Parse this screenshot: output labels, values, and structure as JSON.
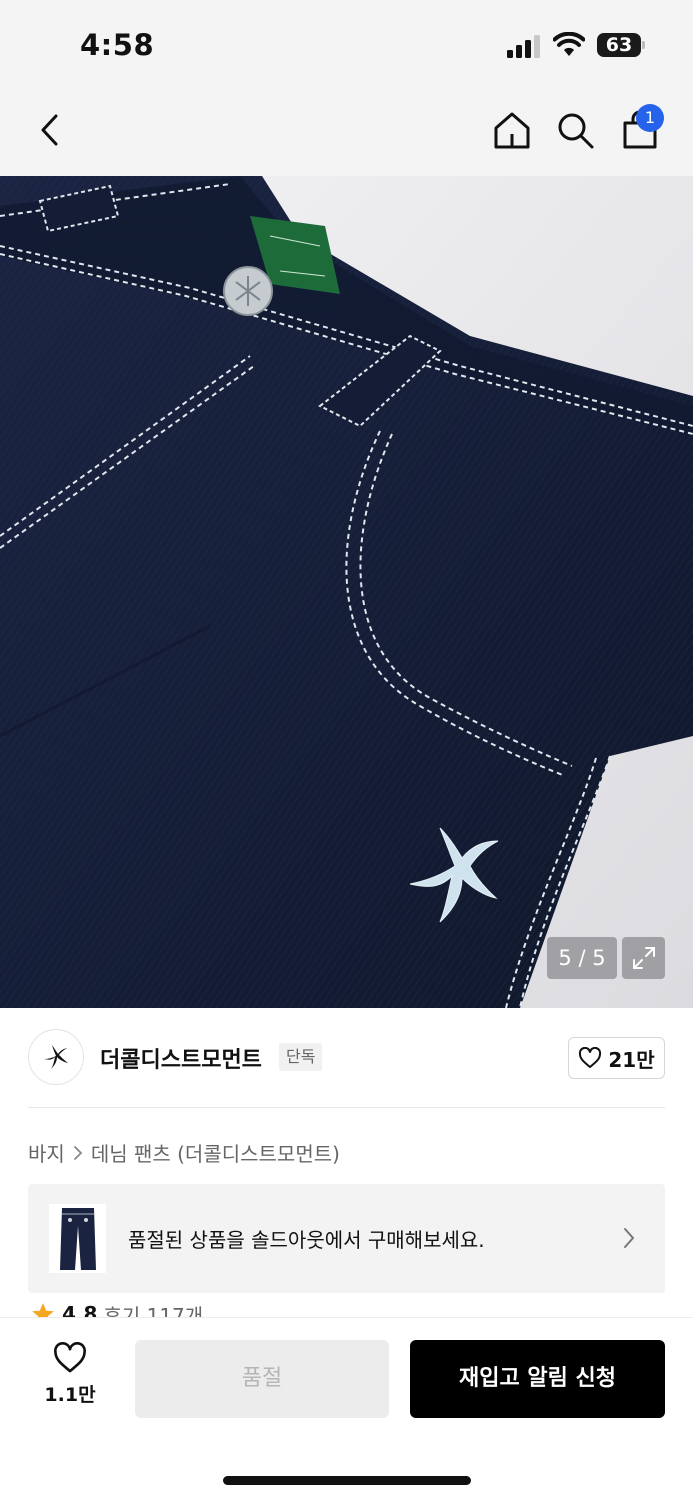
{
  "status_bar": {
    "time": "4:58",
    "battery_level": "63",
    "icons": [
      "cellular-signal-icon",
      "wifi-icon",
      "battery-icon"
    ]
  },
  "nav": {
    "icons": [
      "back-icon",
      "home-icon",
      "search-icon",
      "cart-icon"
    ],
    "cart_count": "1"
  },
  "product_image": {
    "counter": "5 / 5",
    "icons": [
      "expand-icon"
    ],
    "colors": {
      "denim": "#141d35",
      "stitch": "#dfe8ee",
      "tag": "#1e6b3a"
    }
  },
  "brand": {
    "name": "더콜디스트모먼트",
    "badge": "단독",
    "like_count": "21만"
  },
  "breadcrumb": {
    "category": "바지",
    "subcategory": "데님 팬츠 (더콜디스트모먼트)"
  },
  "soldout_banner": {
    "text": "품절된 상품을 솔드아웃에서 구매해보세요."
  },
  "rating": {
    "score": "4.8",
    "reviews": "후기 117개",
    "star_color": "#f5a623"
  },
  "bottom_bar": {
    "wish_count": "1.1만",
    "soldout_label": "품절",
    "restock_label": "재입고 알림 신청"
  },
  "colors": {
    "accent_badge": "#2563eb",
    "primary_button": "#000000",
    "disabled_button": "#ececec"
  }
}
